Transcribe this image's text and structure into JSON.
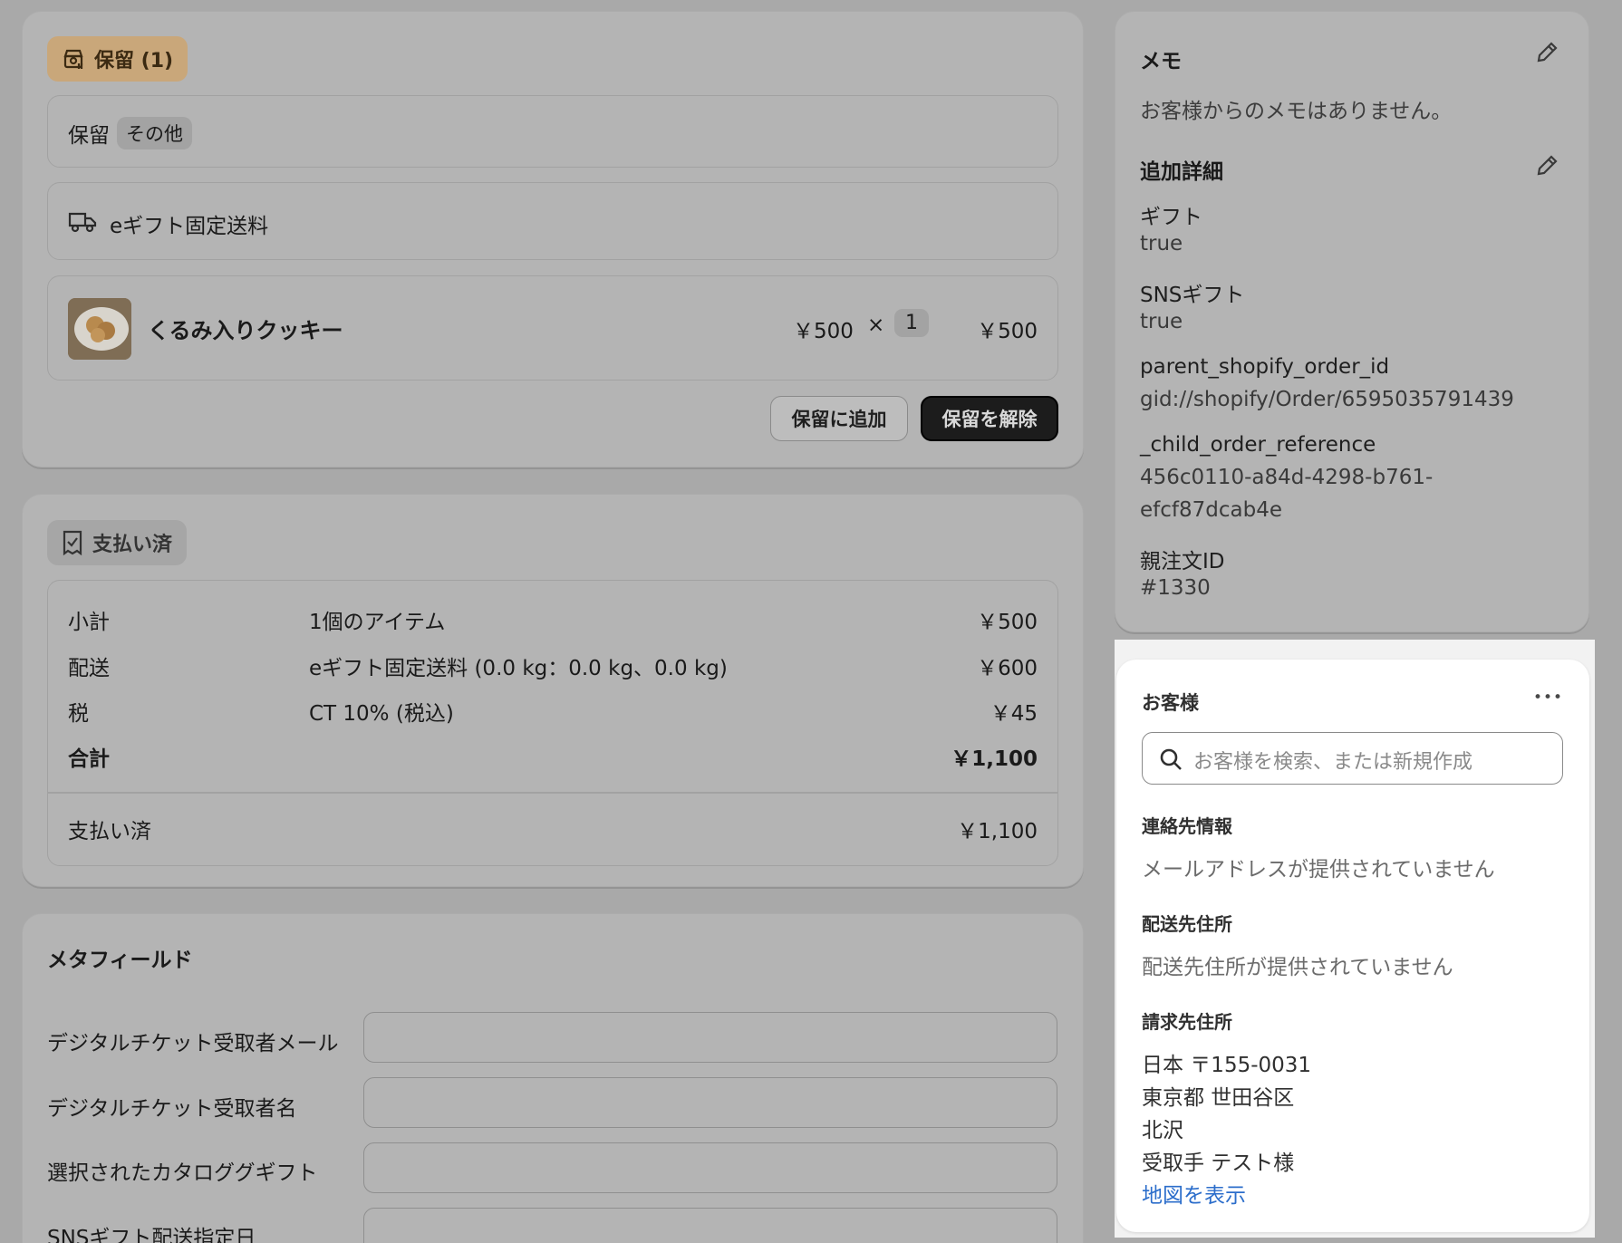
{
  "hold": {
    "badge": "保留 (1)",
    "reason_label": "保留",
    "reason_tag": "その他",
    "shipping_method": "eギフト固定送料",
    "item": {
      "name": "くるみ入りクッキー",
      "unit_price": "￥500",
      "times": "×",
      "quantity": "1",
      "total": "￥500"
    },
    "add_button": "保留に追加",
    "release_button": "保留を解除"
  },
  "payment": {
    "badge": "支払い済",
    "rows": [
      {
        "label": "小計",
        "detail": "1個のアイテム",
        "amount": "￥500"
      },
      {
        "label": "配送",
        "detail": "eギフト固定送料 (0.0 kg：0.0 kg、0.0 kg)",
        "amount": "￥600"
      },
      {
        "label": "税",
        "detail": "CT 10% (税込)",
        "amount": "￥45"
      }
    ],
    "total_label": "合計",
    "total_amount": "￥1,100",
    "paid_label": "支払い済",
    "paid_amount": "￥1,100"
  },
  "metafields": {
    "title": "メタフィールド",
    "fields": [
      {
        "label": "デジタルチケット受取者メール",
        "value": ""
      },
      {
        "label": "デジタルチケット受取者名",
        "value": ""
      },
      {
        "label": "選択されたカタロググギフト",
        "value": ""
      },
      {
        "label": "SNSギフト配送指定日",
        "value": ""
      }
    ]
  },
  "notes": {
    "title": "メモ",
    "empty": "お客様からのメモはありません。",
    "details_title": "追加詳細",
    "details": [
      {
        "key": "ギフト",
        "value": "true"
      },
      {
        "key": "SNSギフト",
        "value": "true"
      },
      {
        "key": "parent_shopify_order_id",
        "value": "gid://shopify/Order/6595035791439"
      },
      {
        "key": "_child_order_reference",
        "value": "456c0110-a84d-4298-b761-",
        "value2": "efcf87dcab4e"
      },
      {
        "key": "親注文ID",
        "value": "#1330"
      }
    ]
  },
  "customer": {
    "title": "お客様",
    "more": "•••",
    "search_placeholder": "お客様を検索、または新規作成",
    "contact_title": "連絡先情報",
    "contact_text": "メールアドレスが提供されていません",
    "shipping_title": "配送先住所",
    "shipping_text": "配送先住所が提供されていません",
    "billing_title": "請求先住所",
    "billing_lines": [
      "日本 〒155-0031",
      "東京都 世田谷区",
      "北沢",
      "受取手 テスト様"
    ],
    "map_link": "地図を表示"
  },
  "colors": {
    "hold_badge": "#c9a77a",
    "paid_badge": "#a6a6a6",
    "primary_button": "#1c1c1c",
    "link": "#2c6ecb",
    "customer_bg": "#ffffff"
  }
}
